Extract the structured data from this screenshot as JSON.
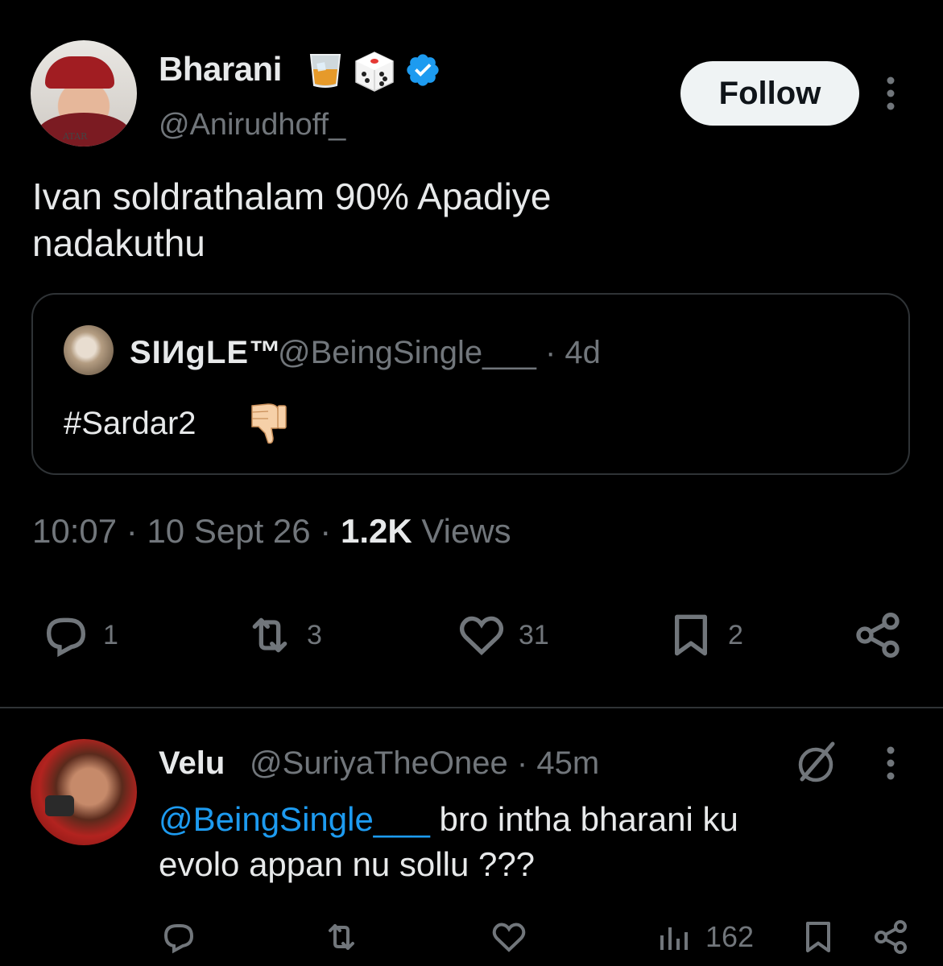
{
  "tweet": {
    "author_name": "Bharani",
    "author_handle": "@Anirudhoff_",
    "avatar_text": "ATAR",
    "follow_label": "Follow",
    "text_line1": "Ivan soldrathalam 90% Apadiye",
    "text_line2": "nadakuthu",
    "time": "10:07",
    "date": "10 Sept 26",
    "views_count": "1.2K",
    "views_label": "Views",
    "separator": "·",
    "replies": "1",
    "reposts": "3",
    "likes": "31",
    "bookmarks": "2"
  },
  "quote": {
    "author_name": "SIИɡLE™",
    "author_handle": "@BeingSingle___",
    "age": "· 4d",
    "text": "#Sardar2"
  },
  "reply": {
    "author_name": "Velu",
    "author_handle": "@SuriyaTheOnee",
    "age": "· 45m",
    "mention": "@BeingSingle___",
    "text_part1": " bro intha bharani ku",
    "text_line2": "evolo appan nu sollu ???",
    "views": "162"
  },
  "icons": {
    "verified": "verified-badge-icon",
    "reply": "reply-icon",
    "repost": "repost-icon",
    "like": "heart-icon",
    "bookmark": "bookmark-icon",
    "share": "share-icon",
    "analytics": "analytics-icon",
    "grok": "grok-icon",
    "more": "more-vertical-icon"
  },
  "colors": {
    "background": "#000000",
    "text": "#e7e9ea",
    "muted": "#71767b",
    "accent": "#1d9bf0",
    "border": "#2f3336"
  }
}
